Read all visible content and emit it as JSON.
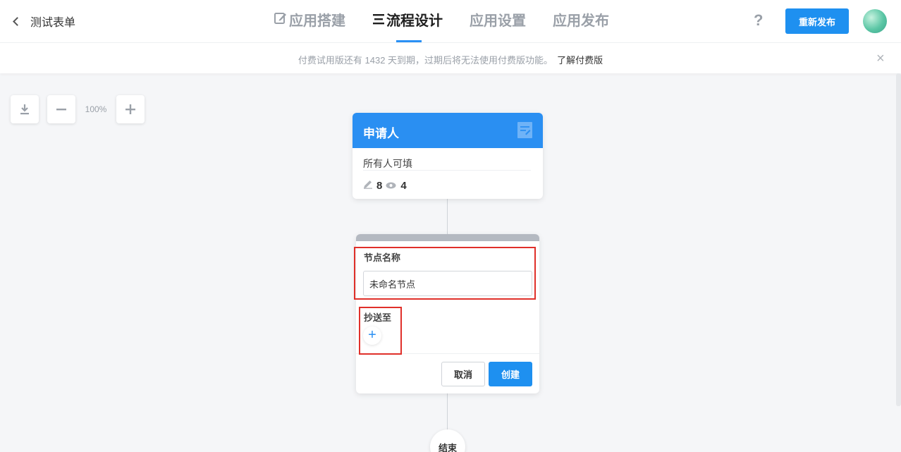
{
  "header": {
    "back_label": "测试表单",
    "tabs": [
      {
        "label": "应用搭建",
        "icon": "edit-icon",
        "active": false
      },
      {
        "label": "流程设计",
        "icon": "flow-icon",
        "active": true
      },
      {
        "label": "应用设置",
        "active": false
      },
      {
        "label": "应用发布",
        "active": false
      }
    ],
    "help_label": "?",
    "publish_label": "重新发布"
  },
  "notice": {
    "message": "付费试用版还有 1432 天到期，过期后将无法使用付费版功能。",
    "link": "了解付费版",
    "close": "×"
  },
  "canvas": {
    "zoom_level": "100%",
    "start_node": {
      "title": "申请人",
      "subtitle": "所有人可填",
      "edit_count": "8",
      "view_count": "4"
    },
    "create_panel": {
      "name_label": "节点名称",
      "name_value": "未命名节点",
      "cc_label": "抄送至",
      "add_label": "+",
      "cancel_label": "取消",
      "create_label": "创建"
    },
    "end_node": {
      "label": "结束"
    }
  },
  "colors": {
    "accent": "#2a8ff2",
    "button": "#1e90f0",
    "highlight": "#e0302a"
  }
}
